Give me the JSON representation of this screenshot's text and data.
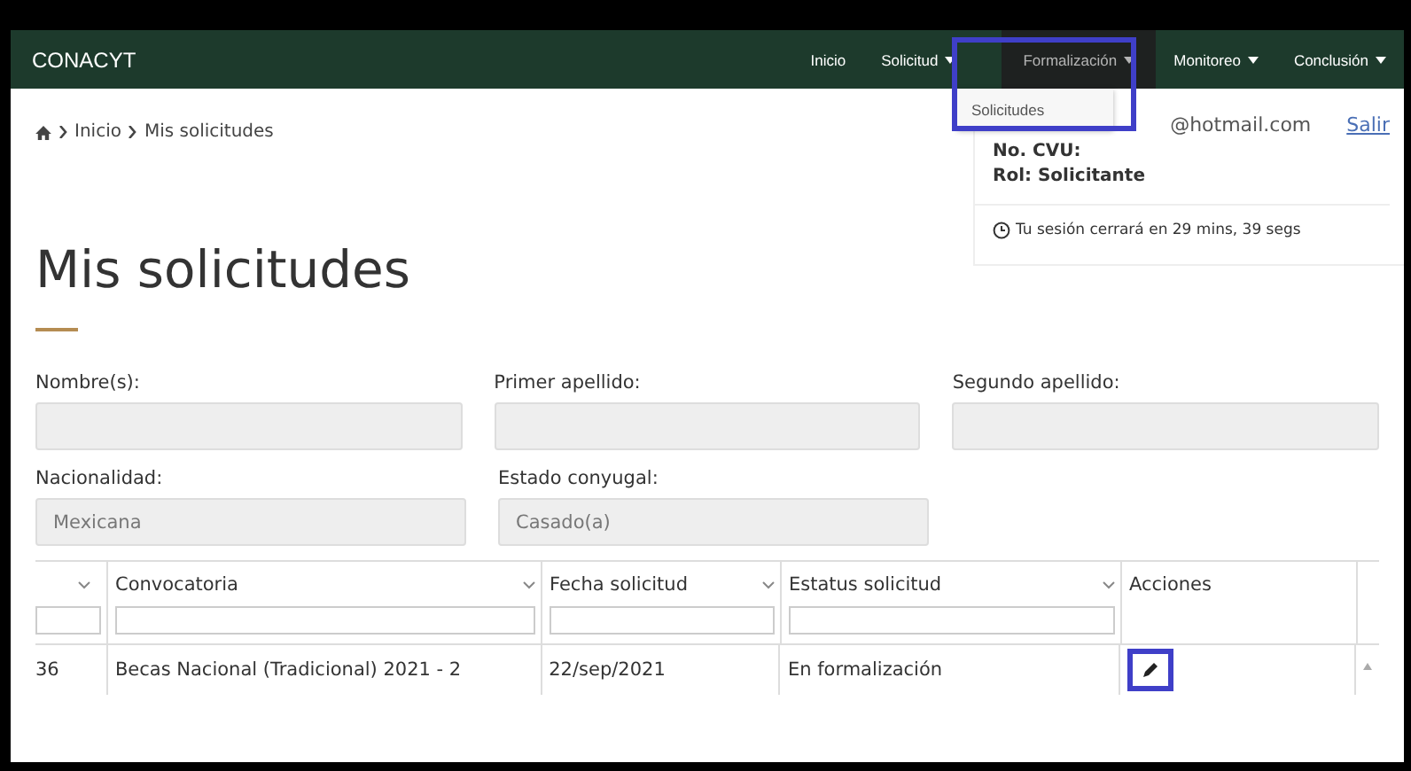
{
  "navbar": {
    "brand": "CONACYT",
    "items": [
      {
        "label": "Inicio",
        "caret": false,
        "selected": false
      },
      {
        "label": "Solicitud",
        "caret": true,
        "selected": false
      },
      {
        "label": "Formalización",
        "caret": true,
        "selected": true
      },
      {
        "label": "Monitoreo",
        "caret": true,
        "selected": false
      },
      {
        "label": "Conclusión",
        "caret": true,
        "selected": false
      }
    ],
    "dropdown": {
      "items": [
        "Solicitudes"
      ]
    }
  },
  "breadcrumb": [
    "Inicio",
    "Mis solicitudes"
  ],
  "user_panel": {
    "email": "@hotmail.com",
    "logout": "Salir",
    "cvu": "No. CVU:",
    "role": "Rol: Solicitante",
    "session": "Tu sesión cerrará en 29 mins, 39 segs"
  },
  "title": "Mis solicitudes",
  "form": {
    "rows": [
      [
        {
          "label": "Nombre(s):"
        },
        {
          "label": "Primer apellido:"
        },
        {
          "label": "Segundo apellido:"
        }
      ],
      [
        {
          "label": "Nacionalidad:",
          "value": "Mexicana"
        },
        {
          "label": "Estado conyugal:",
          "value": "Casado(a)"
        }
      ]
    ]
  },
  "table": {
    "columns": [
      {
        "sortable": true,
        "filter": true
      },
      {
        "label": "Convocatoria",
        "sortable": true,
        "filter": true
      },
      {
        "label": "Fecha solicitud",
        "sortable": true,
        "filter": true
      },
      {
        "label": "Estatus solicitud",
        "sortable": true,
        "filter": true
      },
      {
        "label": "Acciones",
        "sortable": false,
        "filter": false
      }
    ],
    "rows": [
      {
        "cells": [
          "36",
          "Becas Nacional (Tradicional) 2021 - 2",
          "22/sep/2021",
          "En formalización"
        ]
      }
    ]
  }
}
